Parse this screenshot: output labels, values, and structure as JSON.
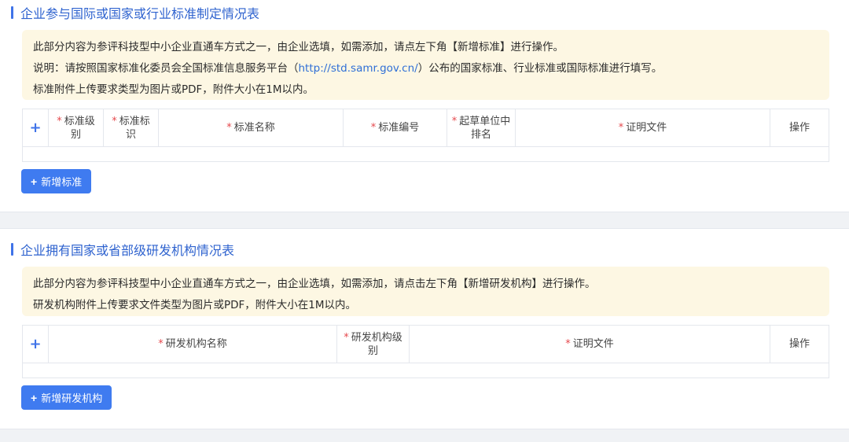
{
  "section1": {
    "title": "企业参与国际或国家或行业标准制定情况表",
    "notice_line1": "此部分内容为参评科技型中小企业直通车方式之一，由企业选填，如需添加，请点左下角【新增标准】进行操作。",
    "notice_line2_prefix": "说明：请按照国家标准化委员会全国标准信息服务平台（",
    "notice_line2_link": "http://std.samr.gov.cn/",
    "notice_line2_suffix": "）公布的国家标准、行业标准或国际标准进行填写。",
    "notice_line3": "标准附件上传要求类型为图片或PDF，附件大小在1M以内。",
    "columns": {
      "add": "+",
      "level": "标准级别",
      "mark": "标准标识",
      "name": "标准名称",
      "number": "标准编号",
      "rank": "起草单位中排名",
      "proof": "证明文件",
      "action": "操作"
    },
    "required_mark": "*",
    "add_button": "新增标准",
    "add_icon": "+"
  },
  "section2": {
    "title": "企业拥有国家或省部级研发机构情况表",
    "notice_line1": "此部分内容为参评科技型中小企业直通车方式之一，由企业选填，如需添加，请点击左下角【新增研发机构】进行操作。",
    "notice_line2": "研发机构附件上传要求文件类型为图片或PDF，附件大小在1M以内。",
    "columns": {
      "add": "+",
      "name": "研发机构名称",
      "level": "研发机构级别",
      "proof": "证明文件",
      "action": "操作"
    },
    "required_mark": "*",
    "add_button": "新增研发机构",
    "add_icon": "+"
  }
}
